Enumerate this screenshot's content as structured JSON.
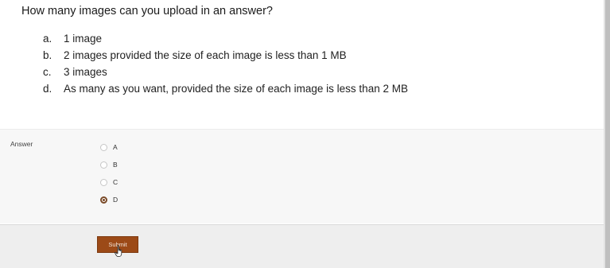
{
  "question": {
    "text": "How many images can you upload in an answer?"
  },
  "options": [
    {
      "letter": "a.",
      "text": "1 image"
    },
    {
      "letter": "b.",
      "text": "2 images provided the size of each image is less than 1 MB"
    },
    {
      "letter": "c.",
      "text": "3 images"
    },
    {
      "letter": "d.",
      "text": "As many as you want, provided the size of each image is less than 2 MB"
    }
  ],
  "answer": {
    "label": "Answer",
    "choices": [
      {
        "label": "A",
        "checked": false
      },
      {
        "label": "B",
        "checked": false
      },
      {
        "label": "C",
        "checked": false
      },
      {
        "label": "D",
        "checked": true
      }
    ],
    "selected": "D"
  },
  "submit": {
    "label": "Submit"
  },
  "colors": {
    "submit_bg": "#9c4a17",
    "radio_checked": "#7a4a28"
  },
  "icons": {
    "cursor": "hand-pointer-icon"
  }
}
